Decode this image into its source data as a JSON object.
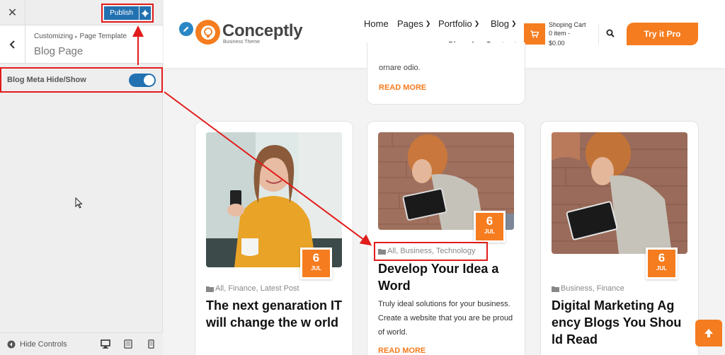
{
  "customizer": {
    "publish_label": "Publish",
    "breadcrumb_root": "Customizing",
    "breadcrumb_parent": "Page Template",
    "panel_title": "Blog Page",
    "control_label": "Blog Meta Hide/Show",
    "control_state": true,
    "hide_controls_label": "Hide Controls"
  },
  "site": {
    "logo_name": "Conceptly",
    "logo_tagline": "Business Theme",
    "nav": {
      "home": "Home",
      "pages": "Pages",
      "portfolio": "Portfolio",
      "blog": "Blog",
      "shop": "Shop",
      "contact": "Contact"
    },
    "cart": {
      "title": "Shoping Cart",
      "items": "0 item -",
      "price": "$0.00"
    },
    "cta_label": "Try it Pro",
    "partial_card": {
      "excerpt_tail": "ornare odio.",
      "read_more": "READ MORE"
    },
    "posts": [
      {
        "day": "6",
        "month": "JUL",
        "meta": "All, Finance, Latest Post",
        "title": "The next genaration IT will change the w orld",
        "excerpt": ""
      },
      {
        "day": "6",
        "month": "JUL",
        "meta": "All, Business, Technology",
        "title": "Develop Your Idea a Word",
        "excerpt": "Truly ideal solutions for your business. Create a website that you are  be proud of world.",
        "read_more": "READ MORE"
      },
      {
        "day": "6",
        "month": "JUL",
        "meta": "Business, Finance",
        "title": "Digital Marketing Ag ency Blogs You Shou ld Read",
        "excerpt": ""
      }
    ]
  },
  "colors": {
    "accent": "#f57c1f",
    "wp_blue": "#2271b1",
    "highlight": "#e21b1b"
  }
}
